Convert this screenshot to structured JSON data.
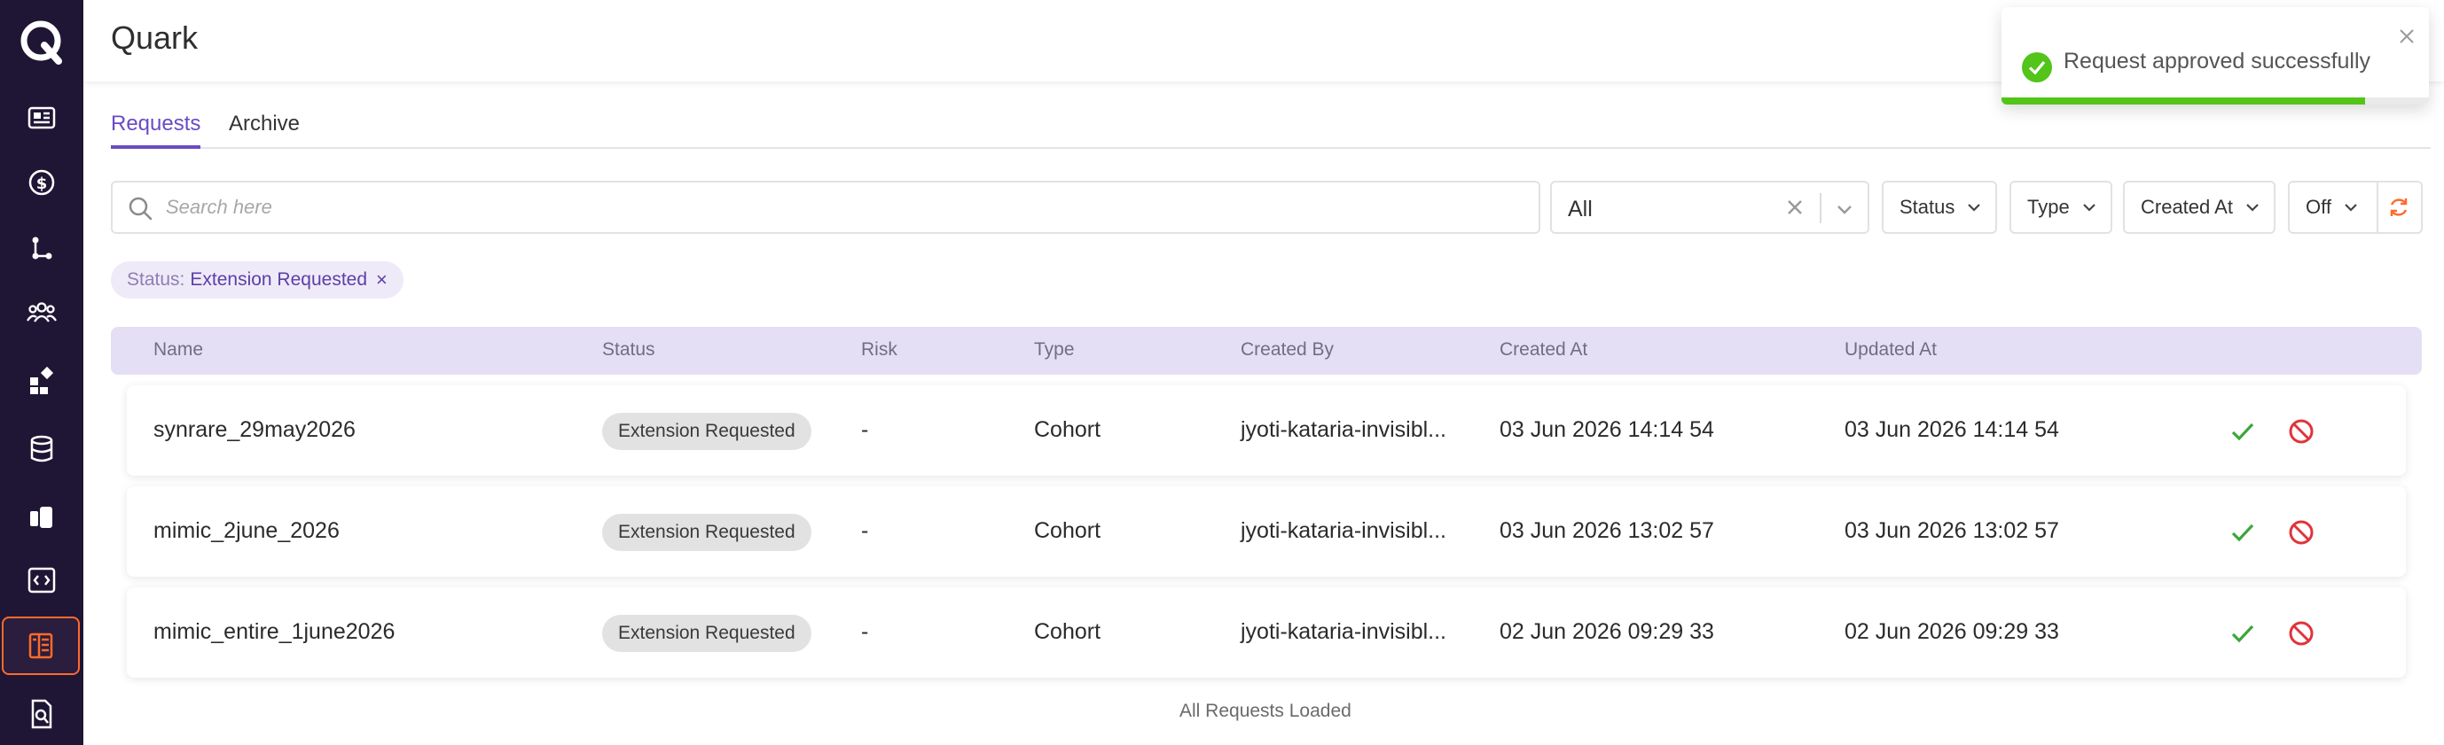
{
  "app": {
    "title": "Quark"
  },
  "sidebar": {
    "logo_letter": "Q",
    "items": [
      {
        "name": "dashboard-icon"
      },
      {
        "name": "dollar-icon"
      },
      {
        "name": "workflow-icon"
      },
      {
        "name": "users-icon"
      },
      {
        "name": "widgets-icon"
      },
      {
        "name": "database-icon"
      },
      {
        "name": "cards-icon"
      },
      {
        "name": "code-icon"
      },
      {
        "name": "requests-icon",
        "active": true
      },
      {
        "name": "file-search-icon"
      }
    ],
    "active_color": "#ff6a2b"
  },
  "tabs": [
    {
      "label": "Requests",
      "active": true
    },
    {
      "label": "Archive",
      "active": false
    }
  ],
  "filters": {
    "search_placeholder": "Search here",
    "scope_value": "All",
    "status_label": "Status",
    "type_label": "Type",
    "created_at_label": "Created At",
    "auto_refresh_label": "Off"
  },
  "active_filter": {
    "key": "Status:",
    "value": "Extension Requested",
    "remove": "×"
  },
  "table": {
    "headers": [
      "Name",
      "Status",
      "Risk",
      "Type",
      "Created By",
      "Created At",
      "Updated At"
    ],
    "rows": [
      {
        "name": "synrare_29may2026",
        "status": "Extension Requested",
        "risk": "-",
        "type": "Cohort",
        "created_by": "jyoti-kataria-invisibl...",
        "created_at": "03 Jun 2026 14:14 54",
        "updated_at": "03 Jun 2026 14:14 54"
      },
      {
        "name": "mimic_2june_2026",
        "status": "Extension Requested",
        "risk": "-",
        "type": "Cohort",
        "created_by": "jyoti-kataria-invisibl...",
        "created_at": "03 Jun 2026 13:02 57",
        "updated_at": "03 Jun 2026 13:02 57"
      },
      {
        "name": "mimic_entire_1june2026",
        "status": "Extension Requested",
        "risk": "-",
        "type": "Cohort",
        "created_by": "jyoti-kataria-invisibl...",
        "created_at": "02 Jun 2026 09:29 33",
        "updated_at": "02 Jun 2026 09:29 33"
      }
    ],
    "footer": "All Requests Loaded"
  },
  "toast": {
    "message": "Request approved successfully",
    "progress_percent": 85,
    "color": "#52c41a"
  },
  "colors": {
    "accent": "#6a4bc4",
    "approve": "#3aa63a",
    "reject": "#e0343a",
    "header_row_bg": "#e5dff5"
  }
}
